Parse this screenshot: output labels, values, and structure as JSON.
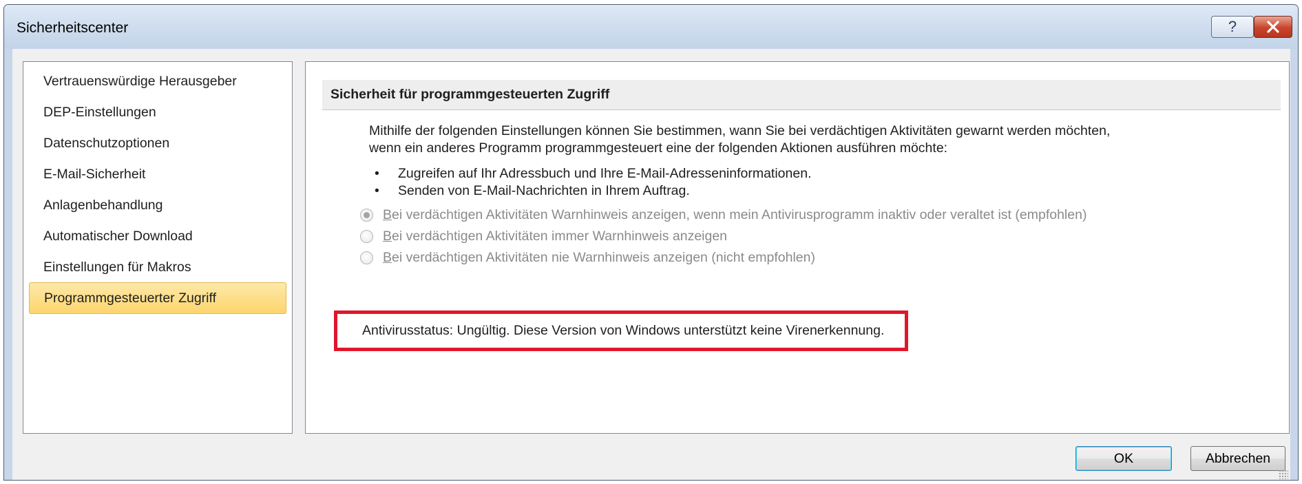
{
  "window": {
    "title": "Sicherheitscenter",
    "help_label": "?"
  },
  "sidebar": {
    "items": [
      {
        "label": "Vertrauenswürdige Herausgeber"
      },
      {
        "label": "DEP-Einstellungen"
      },
      {
        "label": "Datenschutzoptionen"
      },
      {
        "label": "E-Mail-Sicherheit"
      },
      {
        "label": "Anlagenbehandlung"
      },
      {
        "label": "Automatischer Download"
      },
      {
        "label": "Einstellungen für Makros"
      },
      {
        "label": "Programmgesteuerter Zugriff",
        "selected": true
      }
    ]
  },
  "main": {
    "section_title": "Sicherheit für programmgesteuerten Zugriff",
    "description_line1": "Mithilfe der folgenden Einstellungen können Sie bestimmen, wann Sie bei verdächtigen Aktivitäten gewarnt werden möchten,",
    "description_line2": "wenn ein anderes Programm programmgesteuert eine der folgenden Aktionen ausführen möchte:",
    "bullets": [
      "Zugreifen auf Ihr Adressbuch und Ihre E-Mail-Adresseninformationen.",
      "Senden von E-Mail-Nachrichten in Ihrem Auftrag."
    ],
    "options": [
      {
        "accesskey": "B",
        "rest": "ei verdächtigen Aktivitäten Warnhinweis anzeigen, wenn mein Antivirusprogramm inaktiv oder veraltet ist (empfohlen)",
        "selected": true,
        "disabled": true
      },
      {
        "accesskey": "B",
        "rest": "ei verdächtigen Aktivitäten immer Warnhinweis anzeigen",
        "selected": false,
        "disabled": true
      },
      {
        "accesskey": "B",
        "rest": "ei verdächtigen Aktivitäten nie Warnhinweis anzeigen (nicht empfohlen)",
        "selected": false,
        "disabled": true
      }
    ],
    "antivirus_status": "Antivirusstatus: Ungültig. Diese Version von Windows unterstützt keine Virenerkennung."
  },
  "footer": {
    "ok_label": "OK",
    "cancel_label": "Abbrechen"
  },
  "colors": {
    "highlight_border": "#e0162b",
    "selected_item": "#fdd56d",
    "close_button": "#c8452c"
  }
}
